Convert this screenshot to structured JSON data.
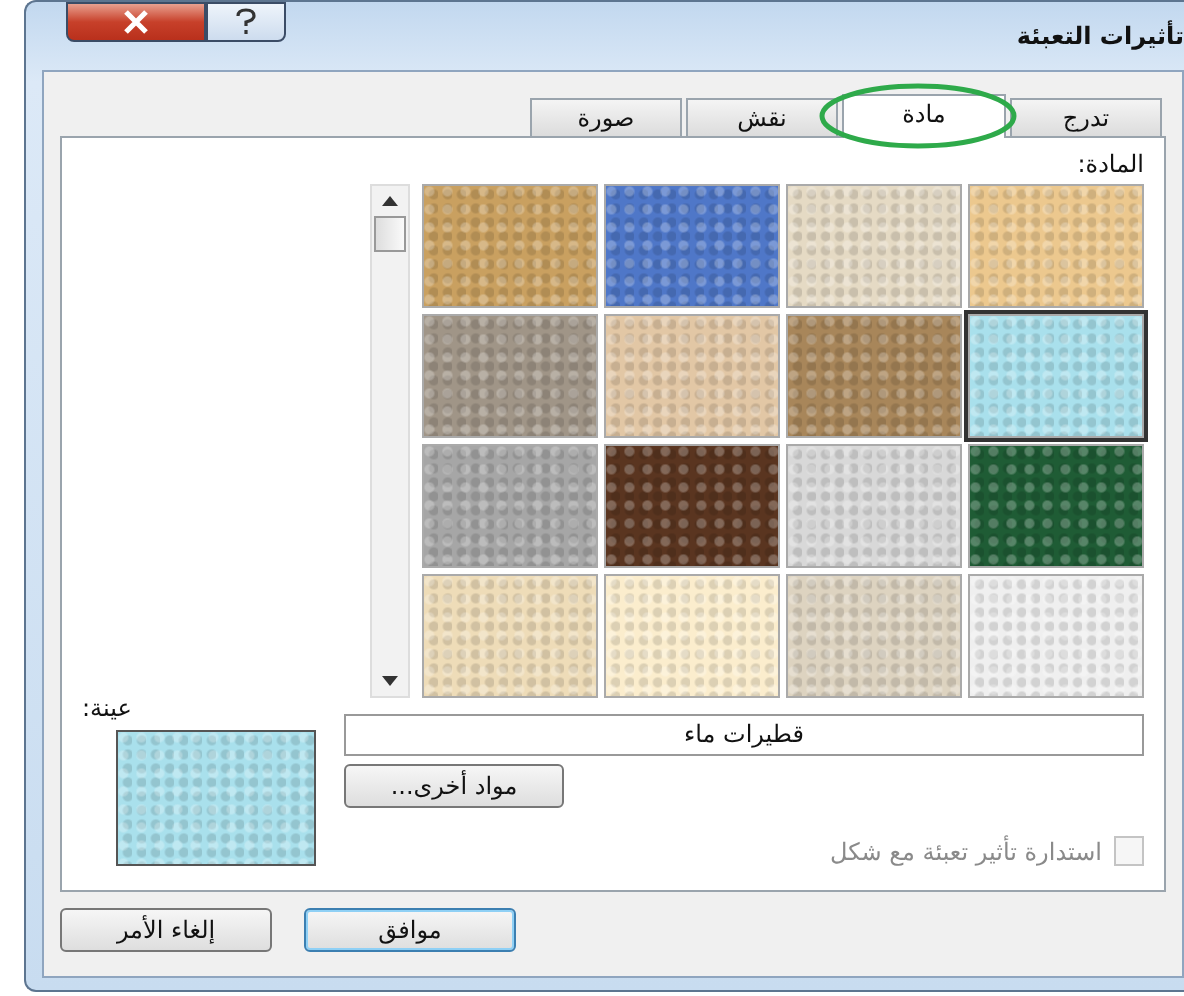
{
  "window": {
    "title": "تأثيرات التعبئة"
  },
  "tabs": [
    {
      "label": "تدرج",
      "selected": false
    },
    {
      "label": "مادة",
      "selected": true
    },
    {
      "label": "نقش",
      "selected": false
    },
    {
      "label": "صورة",
      "selected": false
    }
  ],
  "texture_label": "المادة:",
  "textures": [
    {
      "color": "#ecc88e",
      "selected": false
    },
    {
      "color": "#e5dac4",
      "selected": false
    },
    {
      "color": "#4f77c8",
      "selected": false
    },
    {
      "color": "#c9a060",
      "selected": false
    },
    {
      "color": "#a9e0ec",
      "selected": true
    },
    {
      "color": "#a8865a",
      "selected": false
    },
    {
      "color": "#e2c7a5",
      "selected": false
    },
    {
      "color": "#a09587",
      "selected": false
    },
    {
      "color": "#1f5c35",
      "selected": false
    },
    {
      "color": "#d8d8d8",
      "selected": false
    },
    {
      "color": "#5a3520",
      "selected": false
    },
    {
      "color": "#a6a6a6",
      "selected": false
    },
    {
      "color": "#efefef",
      "selected": false
    },
    {
      "color": "#ddd3c0",
      "selected": false
    },
    {
      "color": "#fbedcd",
      "selected": false
    },
    {
      "color": "#eedcb8",
      "selected": false
    }
  ],
  "texture_name": "قطيرات ماء",
  "other_textures_button": "مواد أخرى...",
  "rotate_with_shape": {
    "label": "استدارة تأثير تعبئة مع شكل",
    "checked": false,
    "disabled": true
  },
  "sample": {
    "label": "عينة:",
    "color": "#a9e0ec"
  },
  "buttons": [
    {
      "label": "موافق",
      "default": true
    },
    {
      "label": "إلغاء الأمر",
      "default": false
    }
  ]
}
